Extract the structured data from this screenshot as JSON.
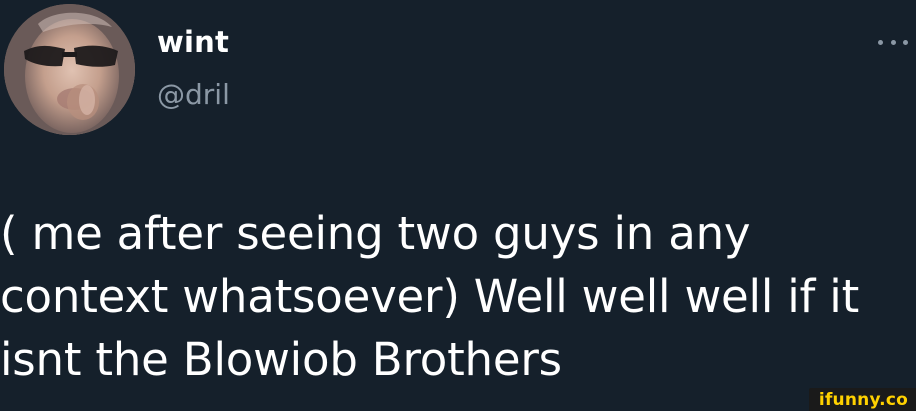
{
  "tweet": {
    "display_name": "wint",
    "handle": "@dril",
    "text_lines": [
      "( me after seeing two guys in any",
      "context whatsoever) Well well well if it",
      "isnt the Blowiob Brothers"
    ],
    "avatar_icon": "profile-avatar-photo",
    "more_icon": "more-options-icon"
  },
  "watermark": {
    "text": "ifunny.co"
  },
  "colors": {
    "background": "#15202b",
    "text_primary": "#ffffff",
    "text_secondary": "#8b98a5",
    "watermark_bg": "#1a1a1a",
    "watermark_text": "#ffd100"
  }
}
